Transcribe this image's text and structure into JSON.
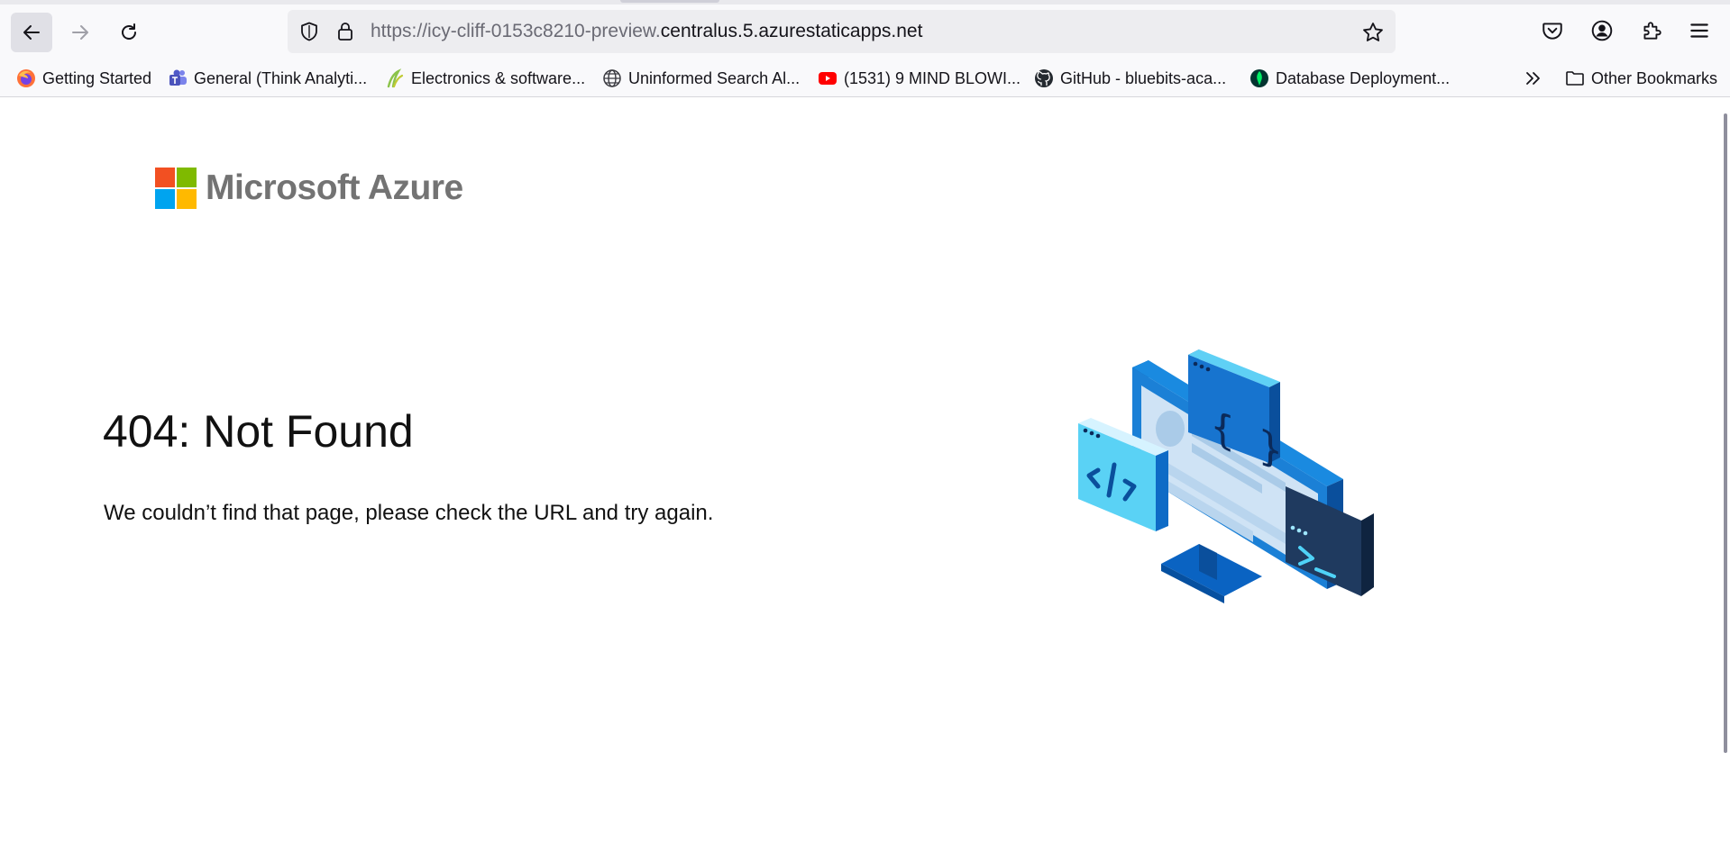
{
  "browser": {
    "url_dim": "https://icy-cliff-0153c8210-preview.",
    "url_main": "centralus.5.azurestaticapps.net",
    "bookmarks": [
      {
        "label": "Getting Started",
        "icon": "firefox-icon"
      },
      {
        "label": "General (Think Analyti...",
        "icon": "teams-icon"
      },
      {
        "label": "Electronics & software...",
        "icon": "leaf-icon"
      },
      {
        "label": "Uninformed Search Al...",
        "icon": "globe-icon"
      },
      {
        "label": "(1531) 9 MIND BLOWI...",
        "icon": "youtube-icon"
      },
      {
        "label": "GitHub - bluebits-aca...",
        "icon": "github-icon"
      },
      {
        "label": "Database Deployment...",
        "icon": "mongodb-icon"
      }
    ],
    "other_bookmarks": "Other Bookmarks"
  },
  "page": {
    "logo_text": "Microsoft Azure",
    "title": "404: Not Found",
    "message": "We couldn’t find that page, please check the URL and try again."
  },
  "colors": {
    "ms_red": "#f25022",
    "ms_green": "#7fba00",
    "ms_blue": "#00a4ef",
    "ms_yellow": "#ffb900",
    "azure_blue": "#0078d4"
  }
}
